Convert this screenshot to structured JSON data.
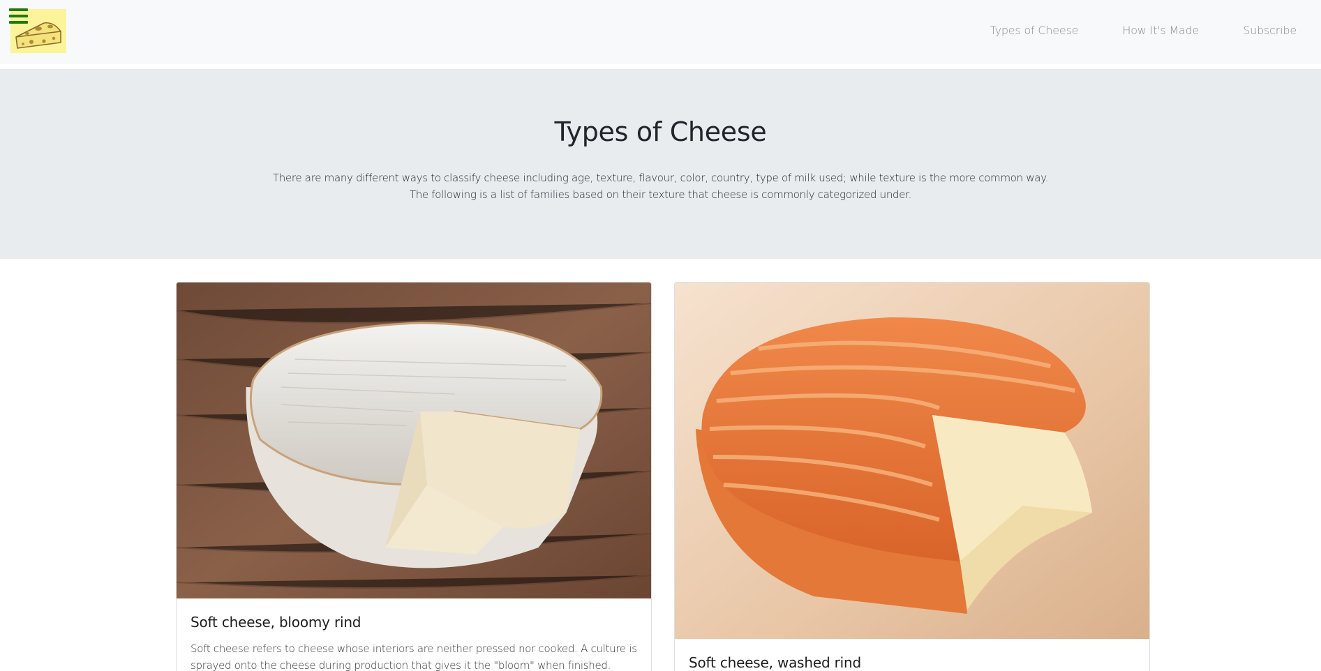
{
  "navbar": {
    "logo_alt": "cheese-logo",
    "links": [
      "Types of Cheese",
      "How It's Made",
      "Subscribe"
    ]
  },
  "hero": {
    "title": "Types of Cheese",
    "lead_line1": "There are many different ways to classify cheese including age, texture, flavour, color, country, type of milk used; while texture is the more common way.",
    "lead_line2": "The following is a list of families based on their texture that cheese is commonly categorized under."
  },
  "cards": [
    {
      "title": "Soft cheese, bloomy rind",
      "text": "Soft cheese refers to cheese whose interiors are neither pressed nor cooked. A culture is sprayed onto the cheese during production that gives it the \"bloom\" when finished.",
      "image": "bloomy-rind-cheese-photo"
    },
    {
      "title": "Soft cheese, washed rind",
      "text": "",
      "image": "washed-rind-cheese-photo"
    }
  ],
  "colors": {
    "navbar_bg": "#f8f9fa",
    "hero_bg": "#e9ecef",
    "hamburger": "#1f7a12",
    "logo_bg": "#fbf49a"
  }
}
